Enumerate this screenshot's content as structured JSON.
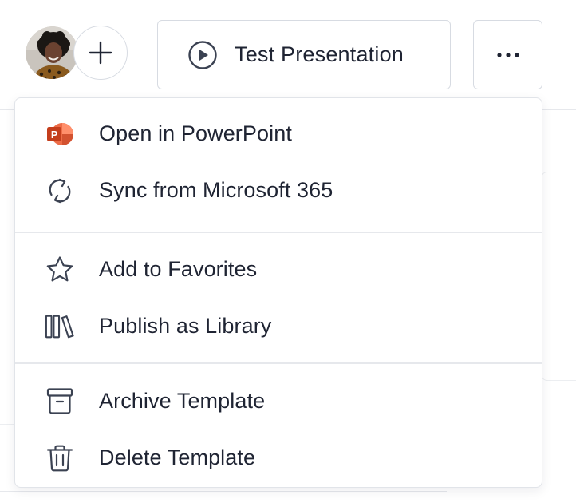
{
  "toolbar": {
    "avatar_alt": "User avatar",
    "add_icon": "plus-icon",
    "test_button": {
      "icon": "play-circle-icon",
      "label": "Test Presentation"
    },
    "more_icon": "more-horizontal-icon"
  },
  "menu": {
    "groups": [
      {
        "items": [
          {
            "icon": "powerpoint-icon",
            "label": "Open in PowerPoint"
          },
          {
            "icon": "sync-icon",
            "label": "Sync from Microsoft 365"
          }
        ]
      },
      {
        "items": [
          {
            "icon": "star-icon",
            "label": "Add to Favorites"
          },
          {
            "icon": "library-icon",
            "label": "Publish as Library"
          }
        ]
      },
      {
        "items": [
          {
            "icon": "archive-icon",
            "label": "Archive Template"
          },
          {
            "icon": "trash-icon",
            "label": "Delete Template"
          }
        ]
      }
    ]
  },
  "colors": {
    "text": "#1f2433",
    "border": "#d7dbe2",
    "icon_stroke": "#3b4252",
    "powerpoint_orange": "#d35230",
    "powerpoint_red": "#c43e1c"
  }
}
